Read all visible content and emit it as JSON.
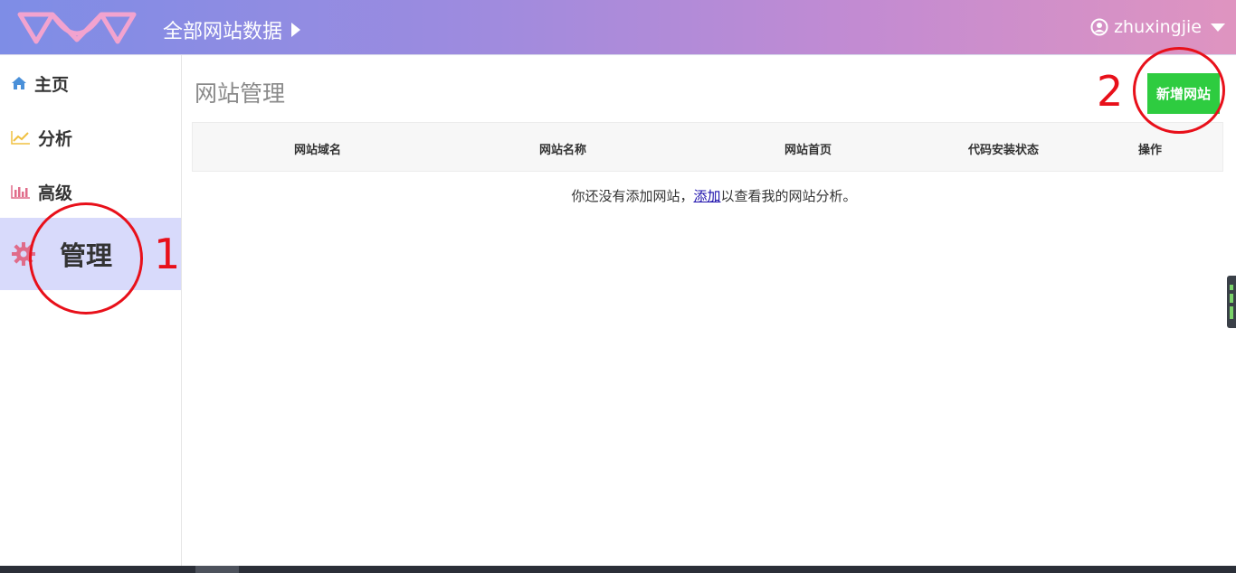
{
  "header": {
    "site_selector": "全部网站数据",
    "username": "zhuxingjie",
    "accent_gradient": [
      "#7e8de6",
      "#df94c0"
    ]
  },
  "sidebar": {
    "items": [
      {
        "label": "主页",
        "icon": "home-icon",
        "color": "#4a90d9"
      },
      {
        "label": "分析",
        "icon": "line-chart-icon",
        "color": "#f0c040"
      },
      {
        "label": "高级",
        "icon": "bar-chart-icon",
        "color": "#e06c8a"
      },
      {
        "label": "管理",
        "icon": "gear-icon",
        "color": "#e06c8a",
        "active": true
      }
    ]
  },
  "main": {
    "title": "网站管理",
    "add_button": "新增网站",
    "table": {
      "columns": [
        "网站域名",
        "网站名称",
        "网站首页",
        "代码安装状态",
        "操作"
      ]
    },
    "empty": {
      "prefix": "你还没有添加网站，",
      "link": "添加",
      "suffix": "以查看我的网站分析。"
    }
  },
  "annotations": {
    "labels": [
      "1",
      "2"
    ],
    "color": "#e8101a"
  }
}
